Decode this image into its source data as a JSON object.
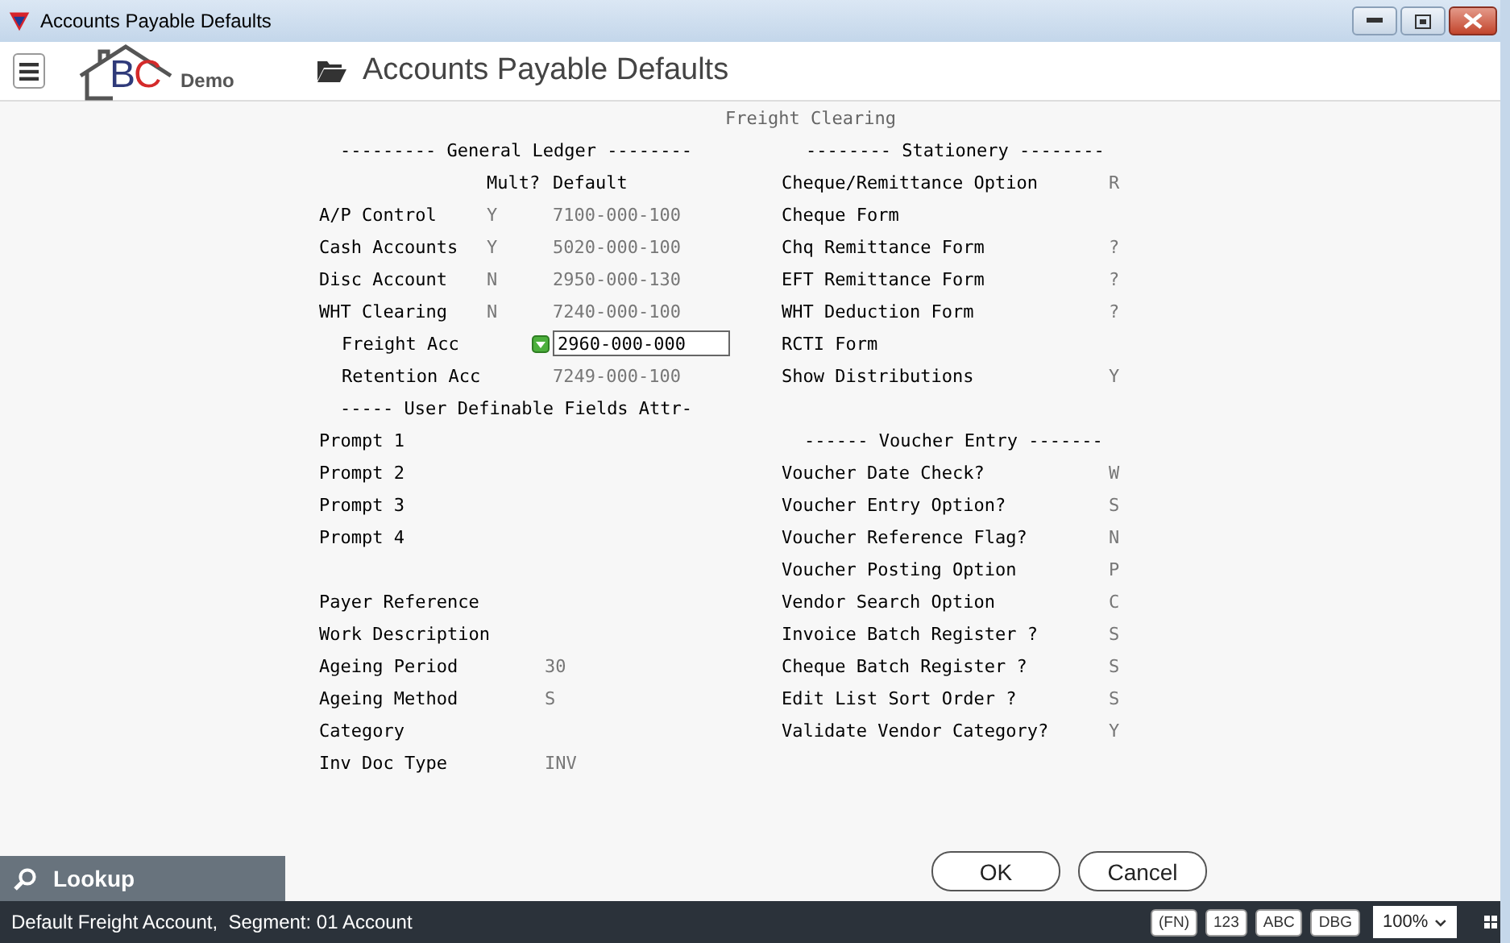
{
  "window": {
    "title": "Accounts Payable Defaults"
  },
  "toolbar": {
    "logo_letters": "BC",
    "logo_caption": "Demo",
    "title": "Accounts Payable Defaults"
  },
  "form": {
    "prompt": "Freight Clearing",
    "left": [
      {
        "heading": "--------- General Ledger --------",
        "column_headers": [
          "Mult?",
          "Default"
        ],
        "rows": [
          {
            "kind": "text",
            "indented": false,
            "label": "A/P Control",
            "mult": "Y",
            "default": "7100-000-100"
          },
          {
            "kind": "text",
            "indented": false,
            "label": "Cash Accounts",
            "mult": "Y",
            "default": "5020-000-100"
          },
          {
            "kind": "text",
            "indented": false,
            "label": "Disc Account",
            "mult": "N",
            "default": "2950-000-130"
          },
          {
            "kind": "text",
            "indented": false,
            "label": "WHT Clearing",
            "mult": "N",
            "default": "7240-000-100"
          },
          {
            "kind": "input",
            "indented": true,
            "label": "Freight Acc",
            "value": "2960-000-000"
          },
          {
            "kind": "text",
            "indented": true,
            "label": "Retention Acc",
            "default": "7249-000-100"
          }
        ]
      },
      {
        "heading": "----- User Definable Fields Attr-",
        "rows": [
          {
            "label": "Prompt 1"
          },
          {
            "label": "Prompt 2"
          },
          {
            "label": "Prompt 3"
          },
          {
            "label": "Prompt 4"
          }
        ]
      },
      {
        "rows": [
          {
            "label": "Payer Reference"
          },
          {
            "label": "Work Description"
          },
          {
            "label": "Ageing Period",
            "value": "30"
          },
          {
            "label": "Ageing Method",
            "value": "S"
          },
          {
            "label": "Category"
          },
          {
            "label": "Inv Doc Type",
            "value": "INV"
          }
        ]
      }
    ],
    "right": [
      {
        "heading": "-------- Stationery --------",
        "rows": [
          {
            "label": "Cheque/Remittance Option",
            "value": "R"
          },
          {
            "label": "Cheque Form"
          },
          {
            "label": "Chq Remittance Form",
            "value": "?"
          },
          {
            "label": "EFT Remittance Form",
            "value": "?"
          },
          {
            "label": "WHT Deduction Form",
            "value": "?"
          },
          {
            "label": "RCTI Form"
          },
          {
            "label": "Show Distributions",
            "value": "Y"
          }
        ]
      },
      {
        "heading": "------ Voucher Entry -------",
        "rows": [
          {
            "label": "Voucher Date Check?",
            "value": "W"
          },
          {
            "label": "Voucher Entry Option?",
            "value": "S"
          },
          {
            "label": "Voucher Reference Flag?",
            "value": "N"
          },
          {
            "label": "Voucher Posting Option",
            "value": "P"
          },
          {
            "label": "Vendor Search Option",
            "value": "C"
          },
          {
            "label": "Invoice Batch Register ?",
            "value": "S"
          },
          {
            "label": "Cheque Batch Register ?",
            "value": "S"
          },
          {
            "label": "Edit List Sort Order ?",
            "value": "S"
          },
          {
            "label": "Validate Vendor Category?",
            "value": "Y"
          }
        ]
      }
    ]
  },
  "lookup": "Lookup",
  "buttons": [
    "OK",
    "Cancel"
  ],
  "status_bar": {
    "message": "Default Freight Account,  Segment: 01 Account",
    "badges": [
      "(FN)",
      "123",
      "ABC",
      "DBG"
    ],
    "zoom": "100%"
  }
}
